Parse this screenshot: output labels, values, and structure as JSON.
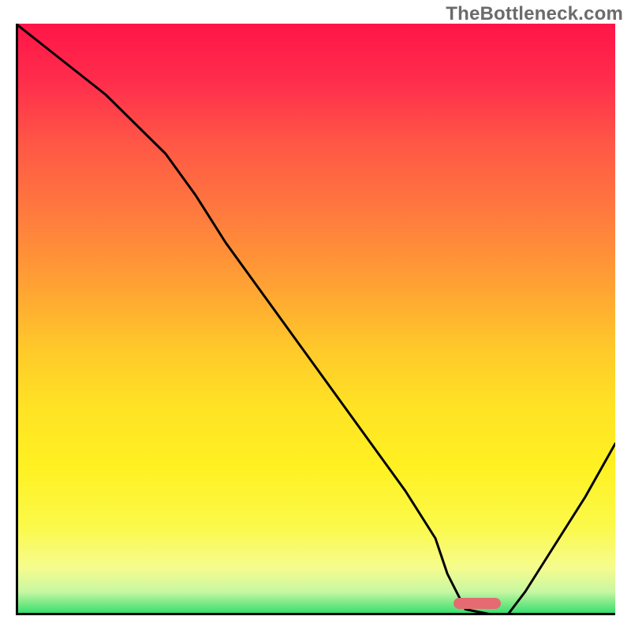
{
  "watermark": "TheBottleneck.com",
  "marker_style": "left:555px; width:60px; bottom:8px;",
  "chart_data": {
    "type": "line",
    "title": "",
    "xlabel": "",
    "ylabel": "",
    "xlim": [
      0,
      100
    ],
    "ylim": [
      0,
      100
    ],
    "x": [
      0,
      5,
      10,
      15,
      20,
      25,
      30,
      35,
      40,
      45,
      50,
      55,
      60,
      65,
      70,
      72,
      75,
      80,
      82,
      85,
      90,
      95,
      100
    ],
    "values": [
      100,
      96,
      92,
      88,
      83,
      78,
      71,
      63,
      56,
      49,
      42,
      35,
      28,
      21,
      13,
      7,
      1,
      0,
      0,
      4,
      12,
      20,
      29
    ],
    "marker_range_x": [
      73,
      81
    ],
    "notes": "V-shaped bottleneck curve over a vertical red→green severity gradient; minimum (0%) around x≈77; curve rises back to ~29% at x=100. No axis tick labels present in the image."
  }
}
